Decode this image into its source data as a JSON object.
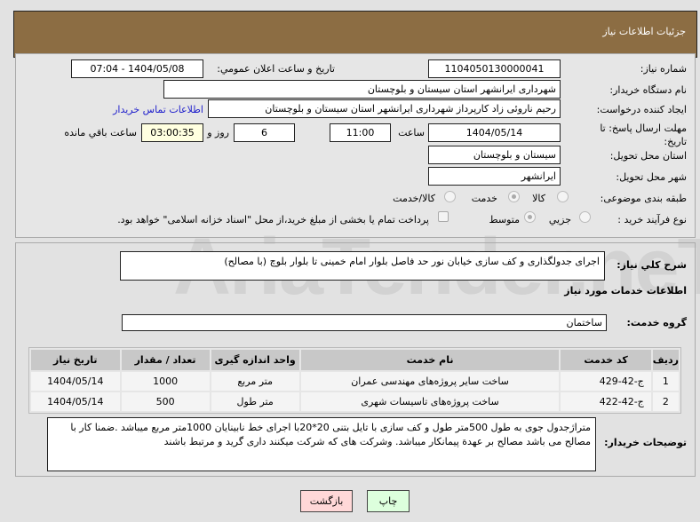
{
  "header": {
    "title": "جزئیات اطلاعات نیاز"
  },
  "form": {
    "need_number_label": "شماره نیاز:",
    "need_number": "1104050130000041",
    "announce_label": "تاریخ و ساعت اعلان عمومي:",
    "announce_value": "1404/05/08 - 07:04",
    "buyer_org_label": "نام دستگاه خریدار:",
    "buyer_org": "شهرداری ایرانشهر استان سیستان و بلوچستان",
    "creator_label": "ایجاد کننده درخواست:",
    "creator": "رحیم ناروئی زاد کارپرداز شهرداری ایرانشهر استان سیستان و بلوچستان",
    "contact_link": "اطلاعات تماس خریدار",
    "deadline_label": "مهلت ارسال پاسخ: تا تاریخ:",
    "deadline_date": "1404/05/14",
    "time_label": "ساعت",
    "deadline_time": "11:00",
    "days": "6",
    "days_label": "روز و",
    "remaining": "03:00:35",
    "remaining_label": "ساعت باقي مانده",
    "province_label": "استان محل تحویل:",
    "province": "سیستان و بلوچستان",
    "city_label": "شهر محل تحویل:",
    "city": "ایرانشهر",
    "category_label": "طبقه بندی موضوعی:",
    "category_options": [
      "کالا",
      "خدمت",
      "کالا/خدمت"
    ],
    "process_label": "نوع فرآیند خرید :",
    "process_options": [
      "جزیي",
      "متوسط"
    ],
    "payment_note": "پرداخت تمام یا بخشی از مبلغ خرید،از محل \"اسناد خزانه اسلامی\" خواهد بود."
  },
  "summary": {
    "label": "شرح کلي نیاز:",
    "text": "اجرای جدولگذاری و کف سازی خیابان نور حد فاصل بلوار امام خمینی تا بلوار بلوچ (با مصالح)"
  },
  "services": {
    "title": "اطلاعات خدمات مورد نیاز",
    "group_label": "گروه خدمت:",
    "group": "ساختمان",
    "columns": [
      "ردیف",
      "کد خدمت",
      "نام خدمت",
      "واحد اندازه گیری",
      "تعداد / مقدار",
      "تاریخ نیاز"
    ],
    "rows": [
      [
        "1",
        "ج-42-429",
        "ساخت سایر پروژه‌های مهندسی عمران",
        "متر مربع",
        "1000",
        "1404/05/14"
      ],
      [
        "2",
        "ج-42-422",
        "ساخت پروژه‌های تاسیسات شهری",
        "متر طول",
        "500",
        "1404/05/14"
      ]
    ]
  },
  "notes": {
    "label": "توضیحات خریدار:",
    "text": "متراژجدول جوی به طول 500متر طول و کف سازی با تایل بتنی 20*20با اجرای خط نابینایان 1000متر مربع میباشد .ضمنا کار با مصالح می باشد مصالح بر عهدة پیمانکار میباشد. وشرکت های که شرکت میکنند داری گرید و مرتبط باشند"
  },
  "buttons": {
    "back": "بازگشت",
    "print": "چاپ"
  },
  "watermark": "AriaTender.neT"
}
